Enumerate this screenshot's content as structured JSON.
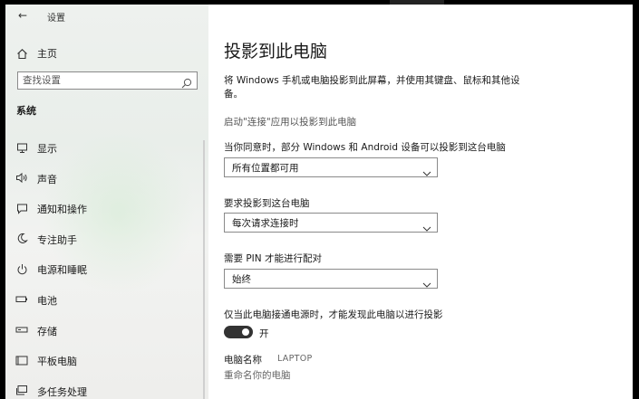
{
  "window": {
    "title": "设置",
    "back_icon": "back-arrow-icon"
  },
  "sidebar": {
    "home_label": "主页",
    "search_placeholder": "查找设置",
    "section_title": "系统",
    "items": [
      {
        "label": "显示",
        "icon": "display-icon"
      },
      {
        "label": "声音",
        "icon": "speaker-icon"
      },
      {
        "label": "通知和操作",
        "icon": "notification-icon"
      },
      {
        "label": "专注助手",
        "icon": "moon-icon"
      },
      {
        "label": "电源和睡眠",
        "icon": "power-icon"
      },
      {
        "label": "电池",
        "icon": "battery-icon"
      },
      {
        "label": "存储",
        "icon": "storage-icon"
      },
      {
        "label": "平板电脑",
        "icon": "tablet-icon"
      },
      {
        "label": "多任务处理",
        "icon": "multitask-icon"
      }
    ]
  },
  "main": {
    "title": "投影到此电脑",
    "description": "将 Windows 手机或电脑投影到此屏幕，并使用其键盘、鼠标和其他设备。",
    "launch_link": "启动\"连接\"应用以投影到此电脑",
    "settings": [
      {
        "label": "当你同意时，部分 Windows 和 Android 设备可以投影到这台电脑",
        "value": "所有位置都可用"
      },
      {
        "label": "要求投影到这台电脑",
        "value": "每次请求连接时"
      },
      {
        "label": "需要 PIN 才能进行配对",
        "value": "始终"
      }
    ],
    "power_label": "仅当此电脑接通电源时，才能发现此电脑以进行投影",
    "power_toggle": {
      "state": "开",
      "on": true
    },
    "pc_name_label": "电脑名称",
    "pc_name_value": "LAPTOP",
    "rename_link": "重命名你的电脑"
  },
  "colors": {
    "accent": "#333333",
    "sidebar_bg": "#eef1ee",
    "border": "#8a8a8a"
  }
}
